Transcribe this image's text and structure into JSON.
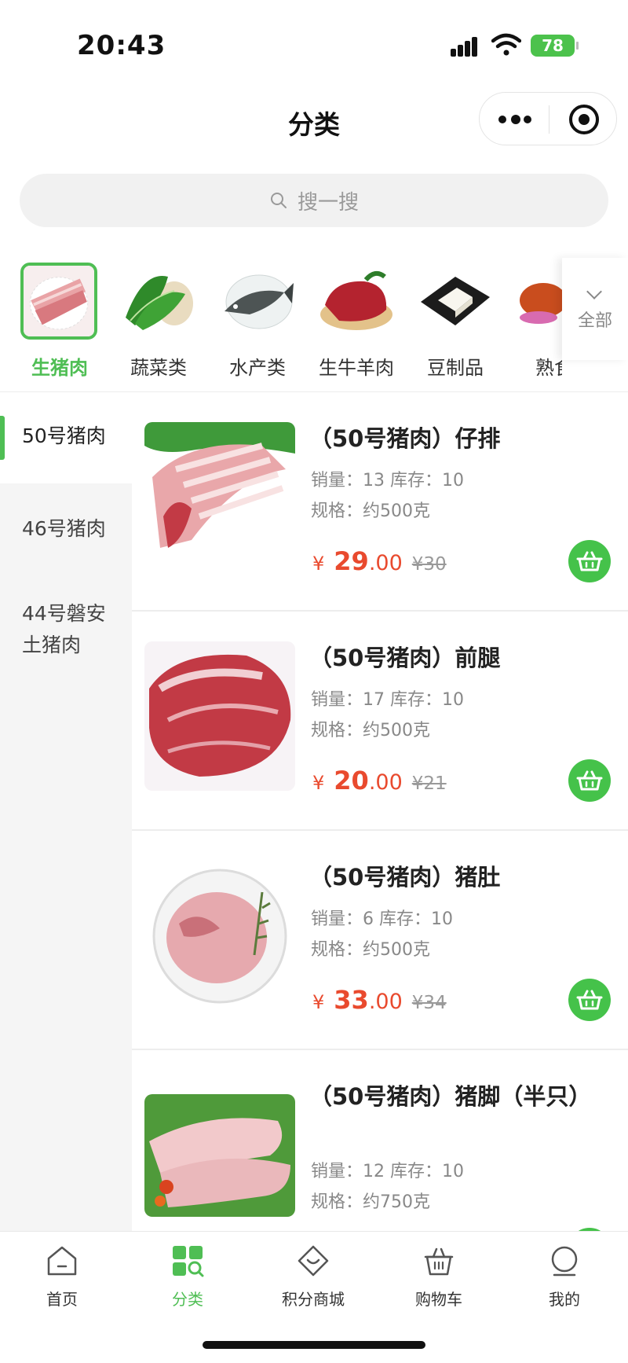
{
  "status_bar": {
    "time": "20:43",
    "battery": "78"
  },
  "nav": {
    "title": "分类"
  },
  "search": {
    "placeholder": "搜一搜"
  },
  "categories": [
    {
      "label": "生猪肉",
      "active": true
    },
    {
      "label": "蔬菜类",
      "active": false
    },
    {
      "label": "水产类",
      "active": false
    },
    {
      "label": "生牛羊肉",
      "active": false
    },
    {
      "label": "豆制品",
      "active": false
    },
    {
      "label": "熟食",
      "active": false
    }
  ],
  "categories_all_label": "全部",
  "side_menu": [
    {
      "label": "50号猪肉",
      "active": true
    },
    {
      "label": "46号猪肉",
      "active": false
    },
    {
      "label": "44号磐安土猪肉",
      "active": false
    }
  ],
  "products": [
    {
      "title": "（50号猪肉）仔排",
      "sales_stock": "销量：13 库存：10",
      "spec": "规格：约500克",
      "currency": "¥",
      "price_int": "29",
      "price_dec": ".00",
      "orig_price": "¥30"
    },
    {
      "title": "（50号猪肉）前腿",
      "sales_stock": "销量：17 库存：10",
      "spec": "规格：约500克",
      "currency": "¥",
      "price_int": "20",
      "price_dec": ".00",
      "orig_price": "¥21"
    },
    {
      "title": "（50号猪肉）猪肚",
      "sales_stock": "销量：6 库存：10",
      "spec": "规格：约500克",
      "currency": "¥",
      "price_int": "33",
      "price_dec": ".00",
      "orig_price": "¥34"
    },
    {
      "title": "（50号猪肉）猪脚（半只）",
      "sales_stock": "销量：12 库存：10",
      "spec": "规格：约750克"
    }
  ],
  "tab_bar": [
    {
      "label": "首页",
      "icon": "home-icon",
      "active": false
    },
    {
      "label": "分类",
      "icon": "category-icon",
      "active": true
    },
    {
      "label": "积分商城",
      "icon": "points-mall-icon",
      "active": false
    },
    {
      "label": "购物车",
      "icon": "cart-icon",
      "active": false
    },
    {
      "label": "我的",
      "icon": "profile-icon",
      "active": false
    }
  ],
  "colors": {
    "accent": "#4fbe54",
    "price": "#e94a2e",
    "cart_button": "#45c24a"
  }
}
